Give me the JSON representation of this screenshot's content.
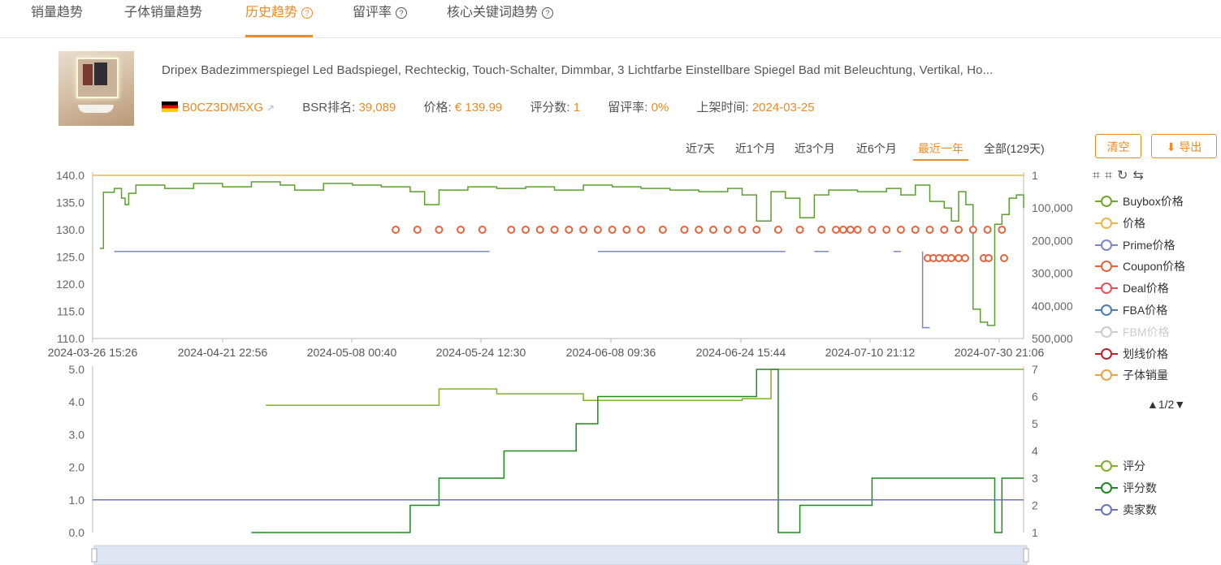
{
  "tabs": [
    {
      "label": "销量趋势",
      "active": false,
      "help": false
    },
    {
      "label": "子体销量趋势",
      "active": false,
      "help": false
    },
    {
      "label": "历史趋势",
      "active": true,
      "help": true
    },
    {
      "label": "留评率",
      "active": false,
      "help": true
    },
    {
      "label": "核心关键词趋势",
      "active": false,
      "help": true
    }
  ],
  "help_glyph": "?",
  "product": {
    "title": "Dripex Badezimmerspiegel Led Badspiegel, Rechteckig, Touch-Schalter, Dimmbar, 3 Lichtfarbe Einstellbare Spiegel Bad mit Beleuchtung, Vertikal, Ho...",
    "asin": "B0CZ3DM5XG",
    "bsr_label": "BSR排名:",
    "bsr_value": "39,089",
    "price_label": "价格:",
    "price_value": "€ 139.99",
    "rating_count_label": "评分数:",
    "rating_count_value": "1",
    "review_rate_label": "留评率:",
    "review_rate_value": "0%",
    "listed_label": "上架时间:",
    "listed_value": "2024-03-25"
  },
  "ranges": [
    {
      "label": "近7天",
      "active": false
    },
    {
      "label": "近1个月",
      "active": false
    },
    {
      "label": "近3个月",
      "active": false
    },
    {
      "label": "近6个月",
      "active": false
    },
    {
      "label": "最近一年",
      "active": true
    },
    {
      "label": "全部(129天)",
      "active": false
    }
  ],
  "buttons": {
    "clear": "清空",
    "export": "导出"
  },
  "legend_top": [
    {
      "label": "Buybox价格",
      "color": "#6fa82a",
      "off": false
    },
    {
      "label": "价格",
      "color": "#e8b84a",
      "off": false
    },
    {
      "label": "Prime价格",
      "color": "#7b86cf",
      "off": false
    },
    {
      "label": "Coupon价格",
      "color": "#e6633c",
      "off": false
    },
    {
      "label": "Deal价格",
      "color": "#e5505a",
      "off": false
    },
    {
      "label": "FBA价格",
      "color": "#4b7db3",
      "off": false
    },
    {
      "label": "FBM价格",
      "color": "#cccccc",
      "off": true
    },
    {
      "label": "划线价格",
      "color": "#c0202a",
      "off": false
    },
    {
      "label": "子体销量",
      "color": "#e8a24a",
      "off": false
    }
  ],
  "legend_pager": "▲1/2▼",
  "legend_bottom": [
    {
      "label": "评分",
      "color": "#7fb224"
    },
    {
      "label": "评分数",
      "color": "#1f8a1f"
    },
    {
      "label": "卖家数",
      "color": "#6b74c4"
    }
  ],
  "chart_data": [
    {
      "type": "line",
      "name": "price-bsr",
      "x_labels": [
        "2024-03-26 15:26",
        "2024-04-21 22:56",
        "2024-05-08 00:40",
        "2024-05-24 12:30",
        "2024-06-08 09:36",
        "2024-06-24 15:44",
        "2024-07-10 21:12",
        "2024-07-30 21:06"
      ],
      "y_left_ticks": [
        "140.0",
        "135.0",
        "130.0",
        "125.0",
        "120.0",
        "115.0",
        "110.0"
      ],
      "y_left_range": [
        110,
        140
      ],
      "y_right_ticks": [
        "1",
        "100,000",
        "200,000",
        "300,000",
        "400,000",
        "500,000"
      ],
      "y_right_range": [
        1,
        500000
      ],
      "x_range": [
        0,
        129
      ],
      "series": [
        {
          "id": "price",
          "color": "#e8b84a",
          "points": [
            [
              0,
              140
            ],
            [
              129,
              140
            ]
          ]
        },
        {
          "id": "bsr",
          "color": "#5aa02c",
          "axis": "right",
          "points": [
            [
              1,
              224000
            ],
            [
              1.5,
              52000
            ],
            [
              3,
              40000
            ],
            [
              4,
              70000
            ],
            [
              4.5,
              90000
            ],
            [
              5,
              55000
            ],
            [
              6,
              30000
            ],
            [
              10,
              40000
            ],
            [
              14,
              25000
            ],
            [
              18,
              35000
            ],
            [
              22,
              20000
            ],
            [
              26,
              30000
            ],
            [
              28,
              45000
            ],
            [
              32,
              25000
            ],
            [
              36,
              30000
            ],
            [
              40,
              35000
            ],
            [
              44,
              50000
            ],
            [
              46,
              90000
            ],
            [
              48,
              45000
            ],
            [
              52,
              35000
            ],
            [
              56,
              40000
            ],
            [
              60,
              35000
            ],
            [
              64,
              45000
            ],
            [
              68,
              30000
            ],
            [
              72,
              35000
            ],
            [
              76,
              40000
            ],
            [
              80,
              45000
            ],
            [
              84,
              50000
            ],
            [
              88,
              40000
            ],
            [
              90,
              60000
            ],
            [
              92,
              140000
            ],
            [
              94,
              50000
            ],
            [
              96,
              70000
            ],
            [
              98,
              130000
            ],
            [
              100,
              60000
            ],
            [
              102,
              45000
            ],
            [
              106,
              50000
            ],
            [
              110,
              40000
            ],
            [
              112,
              60000
            ],
            [
              114,
              30000
            ],
            [
              116,
              80000
            ],
            [
              118,
              100000
            ],
            [
              119,
              140000
            ],
            [
              120,
              50000
            ],
            [
              121,
              90000
            ],
            [
              122,
              410000
            ],
            [
              123,
              450000
            ],
            [
              124,
              460000
            ],
            [
              125,
              150000
            ],
            [
              126,
              120000
            ],
            [
              127,
              70000
            ],
            [
              128,
              60000
            ],
            [
              129,
              100000
            ]
          ]
        },
        {
          "id": "prime",
          "color": "#7b86cf",
          "points": [
            [
              3,
              126
            ],
            [
              55,
              126
            ]
          ],
          "note": "segmented"
        },
        {
          "id": "coupon",
          "color": "#e6633c",
          "points": [
            [
              42,
              130
            ],
            [
              45,
              130
            ],
            [
              48,
              130
            ],
            [
              51,
              130
            ],
            [
              54,
              130
            ],
            [
              58,
              130
            ],
            [
              60,
              130
            ],
            [
              62,
              130
            ],
            [
              64,
              130
            ],
            [
              66,
              130
            ],
            [
              68,
              130
            ],
            [
              70,
              130
            ],
            [
              72,
              130
            ],
            [
              74,
              130
            ],
            [
              76,
              130
            ],
            [
              79,
              130
            ],
            [
              82,
              130
            ],
            [
              84,
              130
            ],
            [
              86,
              130
            ],
            [
              88,
              130
            ],
            [
              90,
              130
            ],
            [
              92,
              130
            ],
            [
              95,
              130
            ],
            [
              98,
              130
            ],
            [
              101,
              130
            ],
            [
              103,
              130
            ],
            [
              104,
              130
            ],
            [
              105,
              130
            ],
            [
              106,
              130
            ],
            [
              108,
              130
            ],
            [
              110,
              130
            ],
            [
              112,
              130
            ],
            [
              114,
              130
            ],
            [
              116,
              130
            ],
            [
              118,
              130
            ],
            [
              120,
              130
            ],
            [
              122,
              130
            ],
            [
              124,
              130
            ],
            [
              126,
              130
            ]
          ]
        }
      ]
    },
    {
      "type": "line",
      "name": "rating-sellers",
      "y_left_ticks": [
        "5.0",
        "4.0",
        "3.0",
        "2.0",
        "1.0",
        "0.0"
      ],
      "y_left_range": [
        0,
        5
      ],
      "y_right_ticks": [
        "7",
        "6",
        "5",
        "4",
        "3",
        "2",
        "1"
      ],
      "y_right_range": [
        1,
        7
      ],
      "series": [
        {
          "id": "rating",
          "color": "#7fb224",
          "points": [
            [
              24,
              3.9
            ],
            [
              48,
              3.9
            ],
            [
              48,
              4.4
            ],
            [
              56,
              4.4
            ],
            [
              56,
              4.25
            ],
            [
              68,
              4.25
            ],
            [
              68,
              4.05
            ],
            [
              90,
              4.05
            ],
            [
              90,
              4.1
            ],
            [
              94,
              4.1
            ],
            [
              94,
              5
            ],
            [
              129,
              5
            ]
          ]
        },
        {
          "id": "rating_count",
          "color": "#1f8a1f",
          "axis": "right",
          "points": [
            [
              22,
              1
            ],
            [
              44,
              1
            ],
            [
              44,
              2
            ],
            [
              48,
              2
            ],
            [
              48,
              3
            ],
            [
              57,
              3
            ],
            [
              57,
              4
            ],
            [
              67,
              4
            ],
            [
              67,
              5
            ],
            [
              70,
              5
            ],
            [
              70,
              6
            ],
            [
              92,
              6
            ],
            [
              92,
              7
            ],
            [
              95,
              7
            ],
            [
              95,
              1
            ],
            [
              98,
              1
            ],
            [
              98,
              2
            ],
            [
              108,
              2
            ],
            [
              108,
              3
            ],
            [
              125,
              3
            ],
            [
              125,
              1
            ],
            [
              126,
              1
            ],
            [
              126,
              3
            ],
            [
              129,
              3
            ]
          ]
        },
        {
          "id": "sellers",
          "color": "#6b74c4",
          "points": [
            [
              0,
              1
            ],
            [
              129,
              1
            ]
          ]
        }
      ]
    }
  ]
}
